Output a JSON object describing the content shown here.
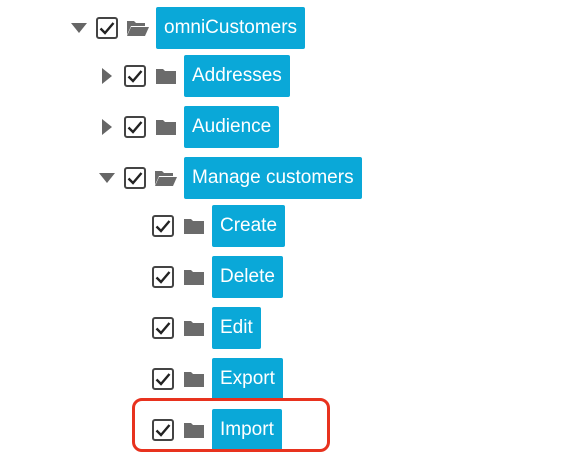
{
  "tree": {
    "root": {
      "label": "omniCustomers",
      "expanded": true,
      "checked": true
    },
    "addresses": {
      "label": "Addresses",
      "expanded": false,
      "checked": true
    },
    "audience": {
      "label": "Audience",
      "expanded": false,
      "checked": true
    },
    "manage_customers": {
      "label": "Manage customers",
      "expanded": true,
      "checked": true,
      "children": [
        {
          "label": "Create",
          "checked": true
        },
        {
          "label": "Delete",
          "checked": true
        },
        {
          "label": "Edit",
          "checked": true
        },
        {
          "label": "Export",
          "checked": true
        },
        {
          "label": "Import",
          "checked": true
        }
      ]
    }
  },
  "colors": {
    "label_bg": "#0aa8d8",
    "label_text": "#ffffff",
    "folder_icon": "#6b6b6b",
    "toggle_icon": "#666666",
    "highlight_border": "#e8321e"
  },
  "highlighted_item": "Import"
}
